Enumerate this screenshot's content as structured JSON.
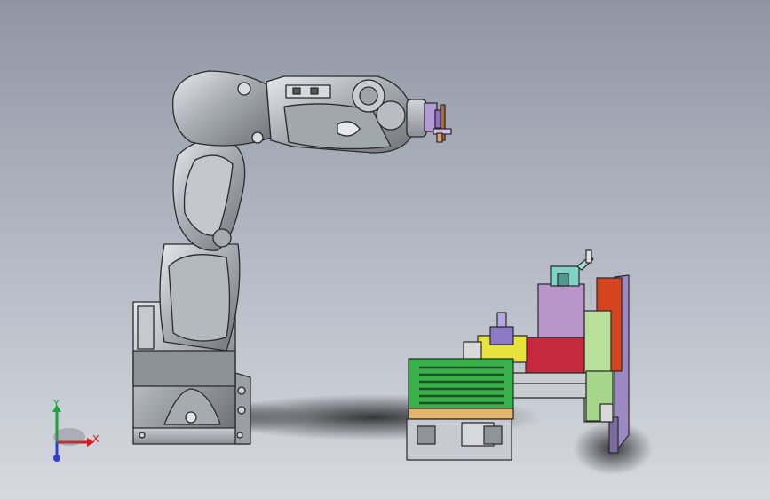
{
  "viewport": {
    "background_top": "#8f96a3",
    "background_bottom": "#d6d9de"
  },
  "triad": {
    "x_label": "X",
    "y_label": "Y",
    "x_color": "#d41a1a",
    "y_color": "#18a53a",
    "z_color": "#2c3fd6"
  },
  "robot": {
    "body_color": "#b9bcc2",
    "edge_color": "#2a2a2a",
    "tool_color": "#b59ad8"
  },
  "fixture": {
    "green_block": "#39b14a",
    "yellow_block": "#e7e23c",
    "purple_block": "#b795c8",
    "red_block": "#c6283c",
    "orange_plate": "#d3441f",
    "violet_plate": "#9c89c3",
    "pale_green": "#b9e09a",
    "teal_part": "#7fd3c6"
  }
}
